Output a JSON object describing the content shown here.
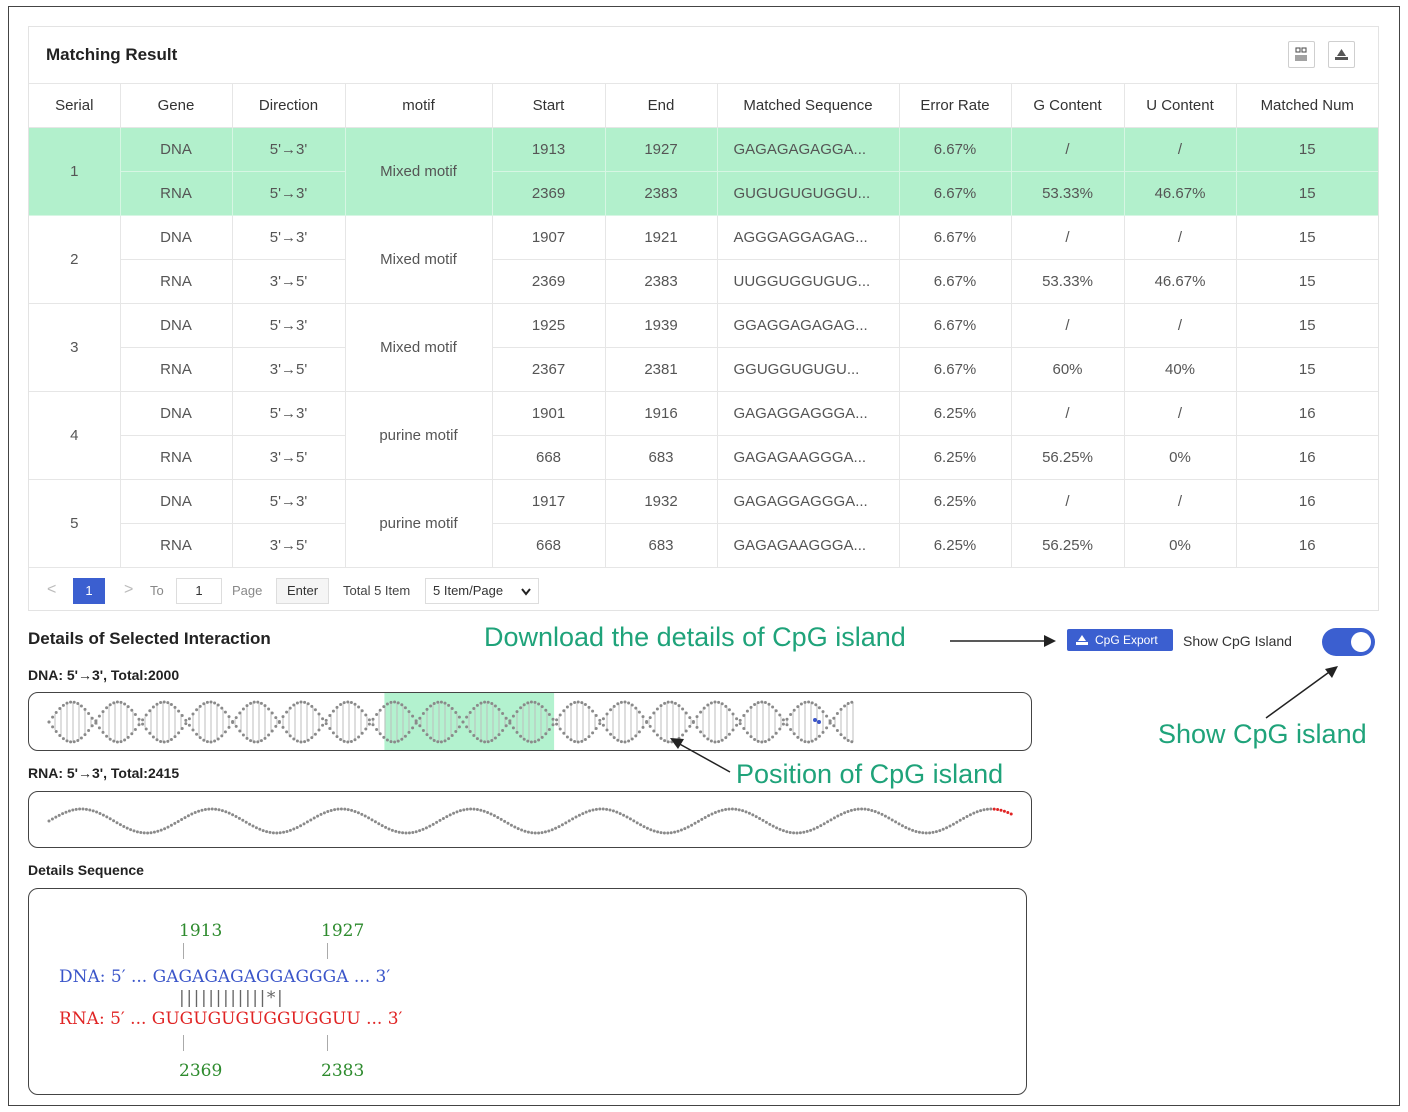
{
  "panel": {
    "title": "Matching Result",
    "icons": [
      "columns-icon",
      "export-icon"
    ]
  },
  "table": {
    "headers": [
      "Serial",
      "Gene",
      "Direction",
      "motif",
      "Start",
      "End",
      "Matched Sequence",
      "Error Rate",
      "G Content",
      "U Content",
      "Matched Num"
    ],
    "rows": [
      {
        "serial": "1",
        "motif": "Mixed motif",
        "selected": true,
        "a": {
          "gene": "DNA",
          "direction": "5'→3'",
          "start": "1913",
          "end": "1927",
          "seq": "GAGAGAGAGGA...",
          "error": "6.67%",
          "g": "/",
          "u": "/",
          "num": "15"
        },
        "b": {
          "gene": "RNA",
          "direction": "5'→3'",
          "start": "2369",
          "end": "2383",
          "seq": "GUGUGUGUGGU...",
          "error": "6.67%",
          "g": "53.33%",
          "u": "46.67%",
          "num": "15"
        }
      },
      {
        "serial": "2",
        "motif": "Mixed motif",
        "selected": false,
        "a": {
          "gene": "DNA",
          "direction": "5'→3'",
          "start": "1907",
          "end": "1921",
          "seq": "AGGGAGGAGAG...",
          "error": "6.67%",
          "g": "/",
          "u": "/",
          "num": "15"
        },
        "b": {
          "gene": "RNA",
          "direction": "3'→5'",
          "start": "2369",
          "end": "2383",
          "seq": "UUGGUGGUGUG...",
          "error": "6.67%",
          "g": "53.33%",
          "u": "46.67%",
          "num": "15"
        }
      },
      {
        "serial": "3",
        "motif": "Mixed motif",
        "selected": false,
        "a": {
          "gene": "DNA",
          "direction": "5'→3'",
          "start": "1925",
          "end": "1939",
          "seq": "GGAGGAGAGAG...",
          "error": "6.67%",
          "g": "/",
          "u": "/",
          "num": "15"
        },
        "b": {
          "gene": "RNA",
          "direction": "3'→5'",
          "start": "2367",
          "end": "2381",
          "seq": "GGUGGUGUGU...",
          "error": "6.67%",
          "g": "60%",
          "u": "40%",
          "num": "15"
        }
      },
      {
        "serial": "4",
        "motif": "purine motif",
        "selected": false,
        "a": {
          "gene": "DNA",
          "direction": "5'→3'",
          "start": "1901",
          "end": "1916",
          "seq": "GAGAGGAGGGA...",
          "error": "6.25%",
          "g": "/",
          "u": "/",
          "num": "16"
        },
        "b": {
          "gene": "RNA",
          "direction": "3'→5'",
          "start": "668",
          "end": "683",
          "seq": "GAGAGAAGGGA...",
          "error": "6.25%",
          "g": "56.25%",
          "u": "0%",
          "num": "16"
        }
      },
      {
        "serial": "5",
        "motif": "purine motif",
        "selected": false,
        "a": {
          "gene": "DNA",
          "direction": "5'→3'",
          "start": "1917",
          "end": "1932",
          "seq": "GAGAGGAGGGA...",
          "error": "6.25%",
          "g": "/",
          "u": "/",
          "num": "16"
        },
        "b": {
          "gene": "RNA",
          "direction": "3'→5'",
          "start": "668",
          "end": "683",
          "seq": "GAGAGAAGGGA...",
          "error": "6.25%",
          "g": "56.25%",
          "u": "0%",
          "num": "16"
        }
      }
    ]
  },
  "pager": {
    "prev": "<",
    "current": "1",
    "next": ">",
    "to_label": "To",
    "to_value": "1",
    "page_label": "Page",
    "enter_label": "Enter",
    "total": "Total 5 Item",
    "per_page": "5 Item/Page"
  },
  "details": {
    "title": "Details of Selected Interaction",
    "export_label": "CpG Export",
    "toggle_label": "Show CpG Island",
    "toggle_on": true,
    "dna_label_name": "DNA",
    "dna_label_rest": ": 5'→3', Total:2000",
    "rna_label_name": "RNA",
    "rna_label_rest": ": 5'→3', Total:2415",
    "cpg_fraction": [
      0.354,
      0.523
    ]
  },
  "annotations": {
    "download": "Download the details of CpG island",
    "show": "Show CpG island",
    "position": "Position of CpG island"
  },
  "sequence": {
    "title": "Details Sequence",
    "dna_start": "1913",
    "dna_end": "1927",
    "dna_line": "DNA: 5′ ... GAGAGAGAGGAGGGA ... 3′",
    "match_line": "||||||||||||*|",
    "rna_line": "RNA: 5′ ... GUGUGUGUGGUGGUU ... 3′",
    "rna_start": "2369",
    "rna_end": "2383"
  },
  "colors": {
    "accent": "#3b5fd0",
    "selected_row": "#b2f0cc",
    "cpg": "#b3f2cf",
    "annot": "#1fa37a",
    "dna_seq": "#3a55c9",
    "rna_seq": "#e02424",
    "pos_num": "#2e8b2e"
  }
}
